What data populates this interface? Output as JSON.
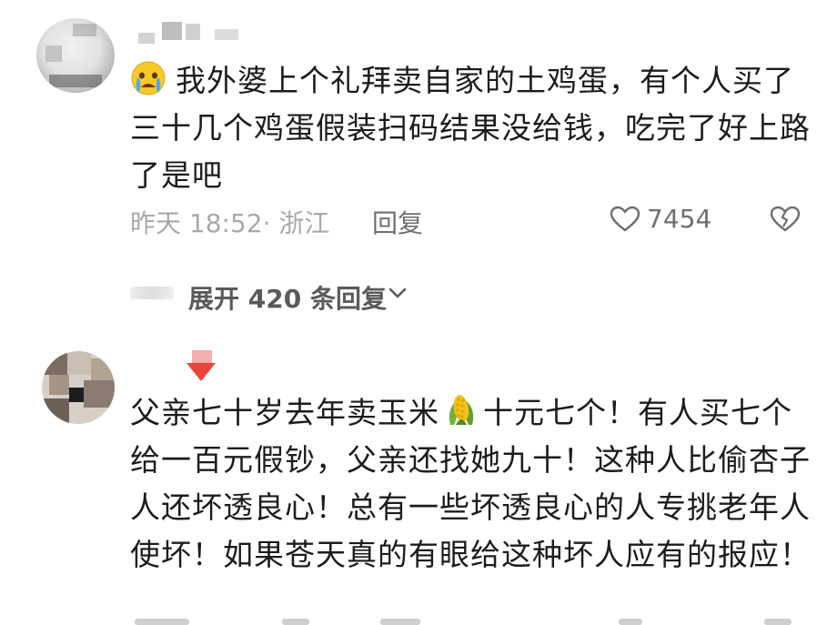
{
  "comments": [
    {
      "text": "我外婆上个礼拜卖自家的土鸡蛋，有个人买了三十几个鸡蛋假装扫码结果没给钱，吃完了好上路了是吧",
      "leading_emoji": "crying-face-icon",
      "time_location": "昨天 18:52· 浙江",
      "reply_label": "回复",
      "like_count": "7454",
      "replies_toggle": "展开 420 条回复"
    },
    {
      "text_before_emoji": "父亲七十岁去年卖玉米",
      "inline_emoji": "corn-icon",
      "text_after_emoji": "十元七个！有人买七个给一百元假钞，父亲还找她九十！这种人比偷杏子人还坏透良心！总有一些坏透良心的人专挑老年人使坏！如果苍天真的有眼给这种坏人应有的报应！"
    }
  ],
  "colors": {
    "text": "#1c1c1c",
    "meta": "#a9a9a9",
    "secondary": "#6f6f6f",
    "badge": "#e8453c"
  }
}
